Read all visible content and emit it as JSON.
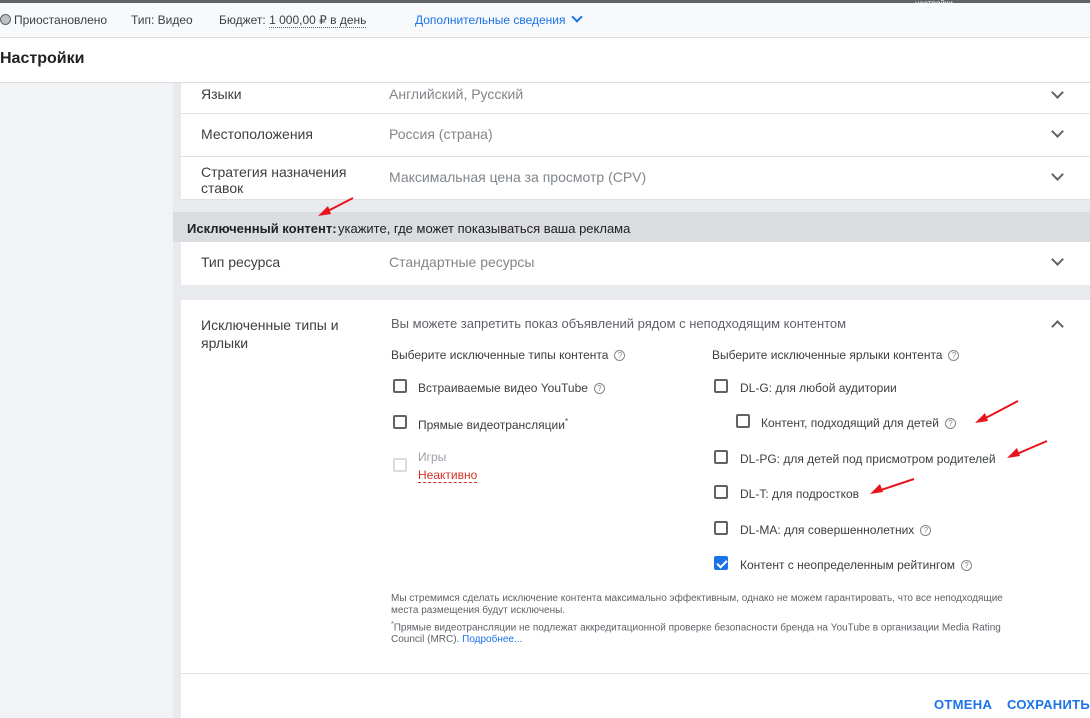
{
  "topbar": {
    "status": "Приостановлено",
    "type": "Тип: Видео",
    "budget_label": "Бюджет:",
    "budget_value": "1 000,00 ₽ в день",
    "more": "Дополнительные сведения",
    "corner": "настройки"
  },
  "page_title": "Настройки",
  "rows": [
    {
      "label": "Языки",
      "value": "Английский, Русский"
    },
    {
      "label": "Местоположения",
      "value": "Россия (страна)"
    },
    {
      "label": "Стратегия назначения ставок",
      "value": "Максимальная цена за просмотр (CPV)"
    }
  ],
  "excluded_section": {
    "title": "Исключенный контент:",
    "subtitle": "укажите, где может показываться ваша реклама"
  },
  "resource_type": {
    "label": "Тип ресурса",
    "value": "Стандартные ресурсы"
  },
  "exclusions": {
    "label": "Исключенные типы и ярлыки",
    "description": "Вы можете запретить показ объявлений рядом с неподходящим контентом",
    "types_heading": "Выберите исключенные типы контента",
    "labels_heading": "Выберите исключенные ярлыки контента",
    "types": [
      {
        "label": "Встраиваемые видео YouTube",
        "checked": false
      },
      {
        "label": "Прямые видеотрансляции",
        "sup": "*",
        "checked": false
      },
      {
        "label": "Игры",
        "status": "Неактивно",
        "checked": false
      }
    ],
    "labels": [
      {
        "label": "DL-G: для любой аудитории",
        "checked": false
      },
      {
        "label": "Контент, подходящий для детей",
        "checked": false
      },
      {
        "label": "DL-PG: для детей под присмотром родителей",
        "checked": false
      },
      {
        "label": "DL-T: для подростков",
        "checked": false
      },
      {
        "label": "DL-MA: для совершеннолетних",
        "checked": false
      },
      {
        "label": "Контент с неопределенным рейтингом",
        "checked": true
      }
    ],
    "note1": "Мы стремимся сделать исключение контента максимально эффективным, однако не можем гарантировать, что все неподходящие места размещения будут исключены.",
    "note2_sup": "*",
    "note2": "Прямые видеотрансляции не подлежат аккредитационной проверке безопасности бренда на YouTube в организации Media Rating Council (MRC).",
    "note_link": "Подробнее..."
  },
  "actions": {
    "cancel": "ОТМЕНА",
    "save": "СОХРАНИТЬ"
  },
  "colors": {
    "accent": "#1a73e8",
    "annotation": "#e8131b",
    "error": "#d93025"
  }
}
